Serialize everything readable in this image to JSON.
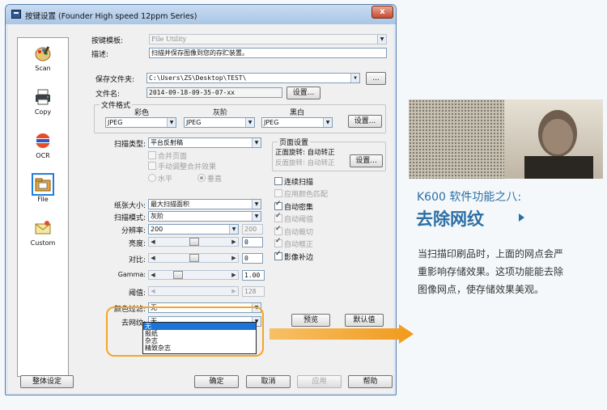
{
  "window": {
    "title": "按键设置 (Founder High speed 12ppm Series)",
    "close": "x"
  },
  "sidebar": {
    "items": [
      {
        "label": "Scan",
        "icon": "palette-icon"
      },
      {
        "label": "Copy",
        "icon": "printer-icon"
      },
      {
        "label": "OCR",
        "icon": "ocr-icon"
      },
      {
        "label": "File",
        "icon": "file-folder-icon",
        "selected": true
      },
      {
        "label": "Custom",
        "icon": "envelope-icon"
      }
    ]
  },
  "top": {
    "template_label": "按键模板:",
    "template_value": "File Utility",
    "desc_label": "描述:",
    "desc_value": "扫描并保存图像到您的存贮装置。"
  },
  "save": {
    "folder_label": "保存文件夹:",
    "folder_value": "C:\\Users\\ZS\\Desktop\\TEST\\",
    "browse": "...",
    "filename_label": "文件名:",
    "filename_value": "2014-09-18-09-35-07-xx",
    "settings": "设置..."
  },
  "format": {
    "group_label": "文件格式",
    "color_label": "彩色",
    "gray_label": "灰阶",
    "bw_label": "黑白",
    "color_value": "JPEG",
    "gray_value": "JPEG",
    "bw_value": "JPEG",
    "settings": "设置..."
  },
  "scan": {
    "type_label": "扫描类型:",
    "type_value": "平台反射稿",
    "merge_pages": "合并页面",
    "manual_merge": "手动调整合并效果",
    "horizontal": "水平",
    "vertical": "垂直",
    "paper_size_label": "纸张大小:",
    "paper_size_value": "最大扫描面积",
    "mode_label": "扫描模式:",
    "mode_value": "灰阶",
    "resolution_label": "分辨率:",
    "resolution_value": "200",
    "resolution_alt": "200",
    "brightness_label": "亮度:",
    "brightness_value": "0",
    "contrast_label": "对比:",
    "contrast_value": "0",
    "gamma_label": "Gamma:",
    "gamma_value": "1.00",
    "threshold_label": "阈值:",
    "threshold_value": "128",
    "color_filter_label": "颜色过滤:",
    "color_filter_value": "无",
    "descreen_label": "去网纹:",
    "descreen_value": "无",
    "descreen_options": [
      "无",
      "报纸",
      "杂志",
      "精致杂志"
    ]
  },
  "page_settings": {
    "group_label": "页面设置",
    "front_rotate": "正面旋转: 自动转正",
    "back_rotate": "反面旋转: 自动转正",
    "settings": "设置..."
  },
  "options": {
    "continuous": "连续扫描",
    "apply_color_match": "应用颜色匹配",
    "auto_density": "自动密集",
    "auto_threshold": "自动阈值",
    "auto_crop": "自动裁切",
    "auto_deskew": "自动框正",
    "image_compensation": "影像补边"
  },
  "buttons": {
    "preview": "预览",
    "default": "默认值",
    "global": "整体设定",
    "ok": "确定",
    "cancel": "取消",
    "apply": "应用",
    "help": "帮助"
  },
  "promo": {
    "subtitle": "K600 软件功能之八:",
    "title": "去除网纹",
    "line1": "当扫描印刷品时，上面的网点会严",
    "line2": "重影响存储效果。这项功能能去除",
    "line3": "图像网点，使存储效果美观。"
  },
  "colors": {
    "accent_blue": "#2c6fa5",
    "highlight_orange": "#f5a623",
    "selection_blue": "#1d74d4"
  }
}
